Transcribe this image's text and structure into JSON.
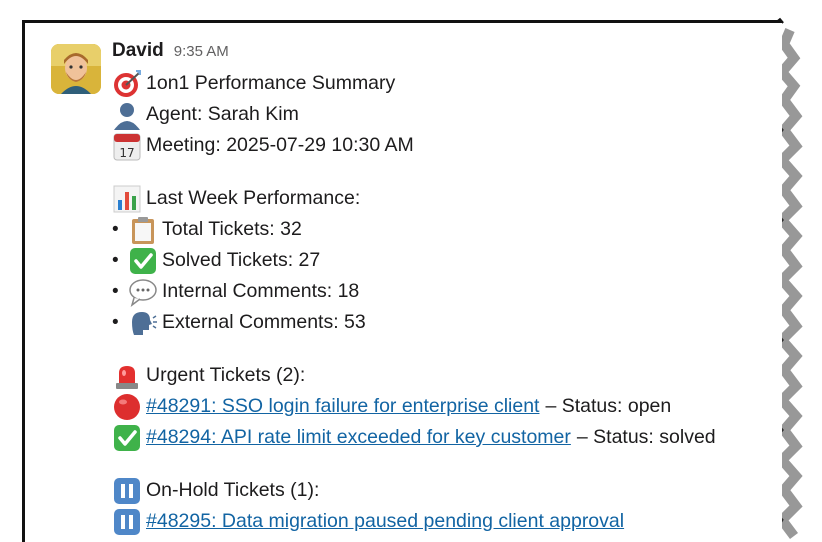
{
  "message": {
    "author": "David",
    "time": "9:35 AM",
    "lines": {
      "title": "1on1 Performance Summary",
      "agent": "Agent: Sarah Kim",
      "meeting": "Meeting: 2025-07-29 10:30 AM",
      "perf_heading": "Last Week Performance:",
      "bullet": "•",
      "total": "Total Tickets: 32",
      "solved": "Solved Tickets: 27",
      "internal": "Internal Comments: 18",
      "external": "External Comments: 53",
      "urgent_heading": "Urgent Tickets (2):",
      "urgent_1_link": "#48291: SSO login failure for enterprise client",
      "urgent_1_status": "– Status: open",
      "urgent_2_link": "#48294: API rate limit exceeded for key customer",
      "urgent_2_status": "– Status: solved",
      "hold_heading": "On-Hold Tickets (1):",
      "hold_1_link": "#48295: Data migration paused pending client approval"
    },
    "calendar_day": "17"
  },
  "icons": {
    "title": "dart-target-icon",
    "agent": "bust-silhouette-icon",
    "meeting": "calendar-icon",
    "perf": "bar-chart-icon",
    "total": "clipboard-icon",
    "solved": "check-mark-button-icon",
    "internal": "speech-bubble-icon",
    "external": "speaking-head-icon",
    "urgent": "police-light-icon",
    "urgent_1": "red-circle-icon",
    "urgent_2": "check-mark-button-icon",
    "hold": "pause-button-icon",
    "hold_1": "pause-button-icon"
  },
  "colors": {
    "link": "#1264a3",
    "text": "#1d1c1d",
    "muted": "#616061"
  }
}
